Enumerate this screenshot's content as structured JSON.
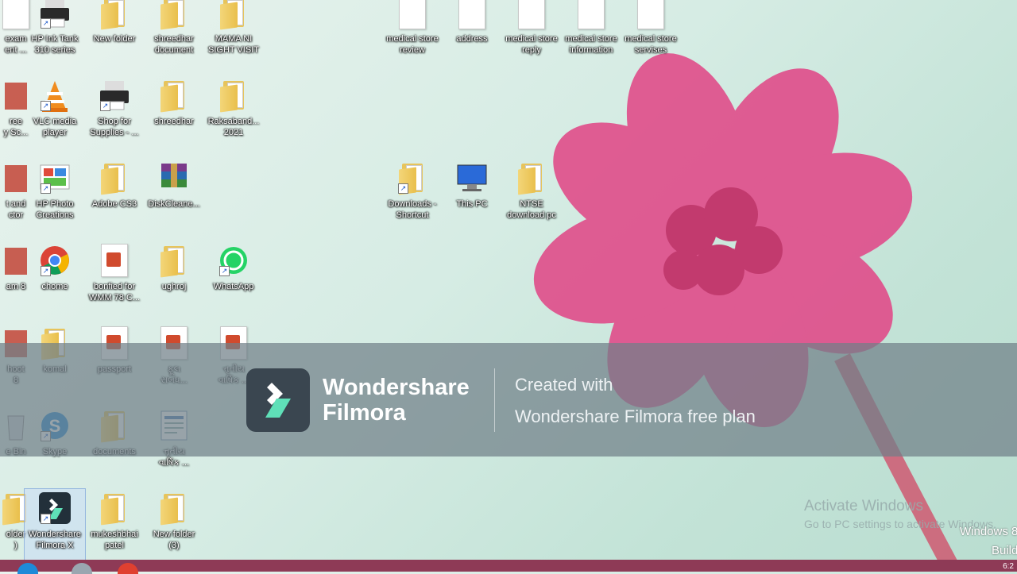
{
  "desktop_icons": [
    {
      "label": "exam\nent ...",
      "icon": "document-icon"
    },
    {
      "label": "HP Ink Tank\n310 series",
      "icon": "printer-icon"
    },
    {
      "label": "New folder",
      "icon": "folder-icon"
    },
    {
      "label": "shreedhar\ndocument",
      "icon": "folder-icon"
    },
    {
      "label": "MAMA NI\nSIGHT VISIT",
      "icon": "folder-icon"
    },
    {
      "label": "medical store\nreview",
      "icon": "document-icon"
    },
    {
      "label": "address",
      "icon": "document-icon"
    },
    {
      "label": "medical store\nreply",
      "icon": "document-icon"
    },
    {
      "label": "medical store\ninformation",
      "icon": "document-icon"
    },
    {
      "label": "medical store\nservises",
      "icon": "document-icon"
    },
    {
      "label": "ree\ny Sc...",
      "icon": "app-icon"
    },
    {
      "label": "VLC media\nplayer",
      "icon": "vlc-icon"
    },
    {
      "label": "Shop for\nSupplies - ...",
      "icon": "printer-icon"
    },
    {
      "label": "shreedhar",
      "icon": "folder-icon"
    },
    {
      "label": "Raksaband...\n2021",
      "icon": "folder-icon"
    },
    {
      "label": "t and\nctor",
      "icon": "app-icon"
    },
    {
      "label": "HP Photo\nCreations",
      "icon": "photo-app-icon"
    },
    {
      "label": "Adobe CS3",
      "icon": "folder-icon"
    },
    {
      "label": "DiskCleane...",
      "icon": "archive-icon"
    },
    {
      "label": "Downloads -\nShortcut",
      "icon": "folder-icon"
    },
    {
      "label": "This PC",
      "icon": "computer-icon"
    },
    {
      "label": "NTSE\ndownload pc",
      "icon": "folder-icon"
    },
    {
      "label": "am 8",
      "icon": "app-icon"
    },
    {
      "label": "chome",
      "icon": "chrome-icon"
    },
    {
      "label": "bonfied for\nWMM 78 C...",
      "icon": "pdf-icon"
    },
    {
      "label": "ughroj",
      "icon": "folder-icon"
    },
    {
      "label": "WhatsApp",
      "icon": "whatsapp-icon"
    },
    {
      "label": "hoot\n8",
      "icon": "app-icon"
    },
    {
      "label": "komal",
      "icon": "folder-icon"
    },
    {
      "label": "passport",
      "icon": "pdf-icon"
    },
    {
      "label": "ફૂલ\nસબંધ...",
      "icon": "pdf-icon"
    },
    {
      "label": "ત્તૃતીય\nવાર્ષિક ...",
      "icon": "pdf-icon"
    },
    {
      "label": "e Bin",
      "icon": "recycle-bin-icon"
    },
    {
      "label": "Skype",
      "icon": "skype-icon"
    },
    {
      "label": "documents",
      "icon": "folder-icon"
    },
    {
      "label": "ત્તૃતીય\nવાર્ષિક ...",
      "icon": "doc-icon"
    },
    {
      "label": "older\n)",
      "icon": "folder-icon"
    },
    {
      "label": "Wondershare\nFilmora X",
      "icon": "filmora-icon"
    },
    {
      "label": "mukeshbhai\npatel",
      "icon": "folder-icon"
    },
    {
      "label": "New folder\n(3)",
      "icon": "folder-icon"
    }
  ],
  "watermark": {
    "brand_line1": "Wondershare",
    "brand_line2": "Filmora",
    "line1": "Created with",
    "line2": "Wondershare Filmora free plan"
  },
  "activation": {
    "title": "Activate Windows",
    "subtitle": "Go to PC settings to activate Windows.",
    "os_name": "Windows 8",
    "build": "Build"
  },
  "taskbar": {
    "clock": "6:2"
  },
  "colors": {
    "taskbar": "#8e3a56",
    "flower": "#e0508c"
  }
}
